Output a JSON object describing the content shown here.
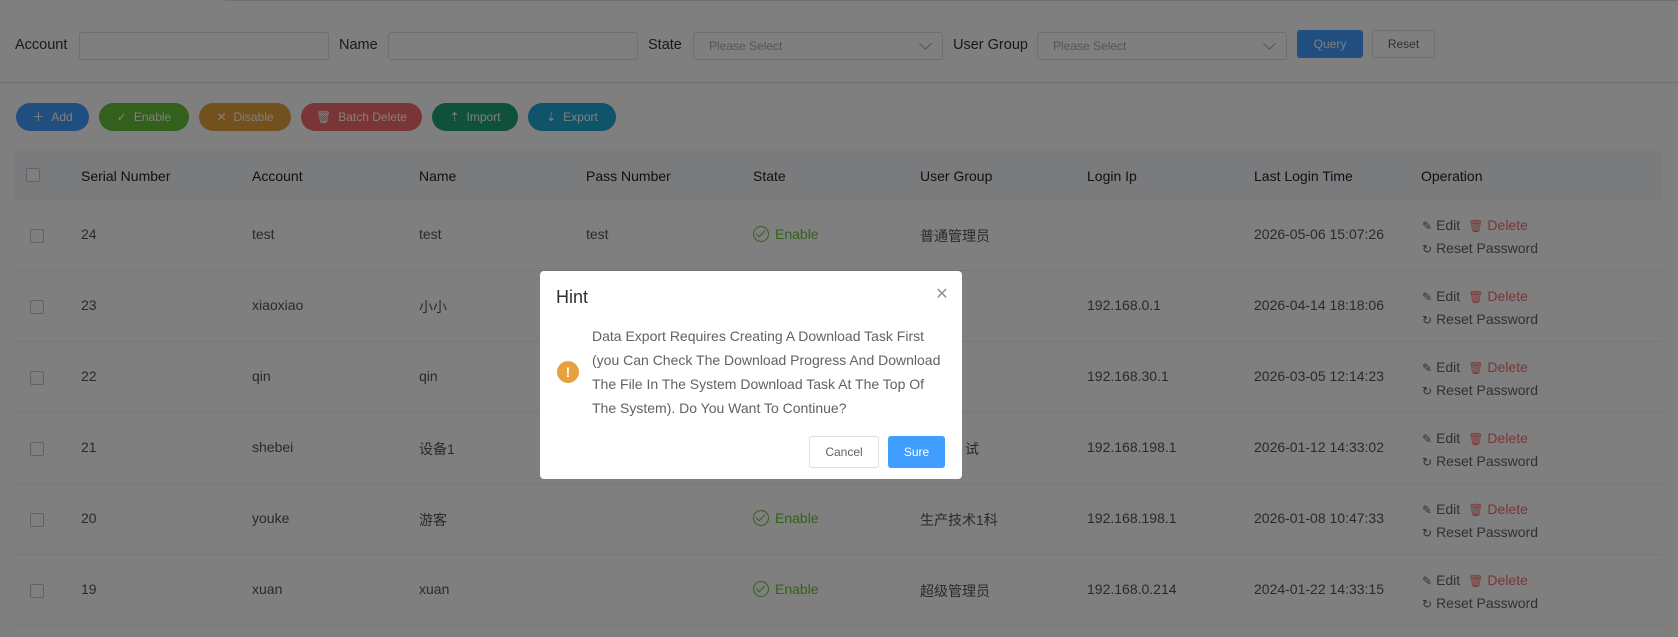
{
  "filters": {
    "account_label": "Account",
    "account_value": "",
    "name_label": "Name",
    "name_value": "",
    "state_label": "State",
    "state_placeholder": "Please Select",
    "group_label": "User Group",
    "group_placeholder": "Please Select",
    "query": "Query",
    "reset": "Reset"
  },
  "actions": {
    "add": "Add",
    "enable": "Enable",
    "disable": "Disable",
    "batch_delete": "Batch Delete",
    "import": "Import",
    "export": "Export"
  },
  "table": {
    "headers": [
      "Serial Number",
      "Account",
      "Name",
      "Pass Number",
      "State",
      "User Group",
      "Login Ip",
      "Last Login Time",
      "Operation"
    ],
    "rows": [
      {
        "serial": "24",
        "account": "test",
        "name": "test",
        "pass": "test",
        "state": "Enable",
        "group": "普通管理员",
        "ip": "",
        "time": "2026-05-06 15:07:26"
      },
      {
        "serial": "23",
        "account": "xiaoxiao",
        "name": "小小",
        "pass": "",
        "state": "",
        "group": "理员",
        "ip": "192.168.0.1",
        "time": "2026-04-14 18:18:06"
      },
      {
        "serial": "22",
        "account": "qin",
        "name": "qin",
        "pass": "",
        "state": "",
        "group": "理员",
        "ip": "192.168.30.1",
        "time": "2026-03-05 12:14:23"
      },
      {
        "serial": "21",
        "account": "shebei",
        "name": "设备1",
        "pass": "",
        "state": "",
        "group": "试",
        "ip": "192.168.198.1",
        "time": "2026-01-12 14:33:02"
      },
      {
        "serial": "20",
        "account": "youke",
        "name": "游客",
        "pass": "",
        "state": "Enable",
        "group": "生产技术1科",
        "ip": "192.168.198.1",
        "time": "2026-01-08 10:47:33"
      },
      {
        "serial": "19",
        "account": "xuan",
        "name": "xuan",
        "pass": "",
        "state": "Enable",
        "group": "超级管理员",
        "ip": "192.168.0.214",
        "time": "2024-01-22 14:33:15"
      }
    ],
    "op_edit": "Edit",
    "op_delete": "Delete",
    "op_reset": "Reset Password"
  },
  "dialog": {
    "title": "Hint",
    "message": "Data Export Requires Creating A Download Task First (you Can Check The Download Progress And Download The File In The System Download Task At The Top Of The System). Do You Want To Continue?",
    "cancel": "Cancel",
    "sure": "Sure"
  },
  "colors": {
    "primary": "#409eff",
    "success": "#67c23a",
    "warning": "#e6a23c",
    "danger": "#f56c6c"
  }
}
